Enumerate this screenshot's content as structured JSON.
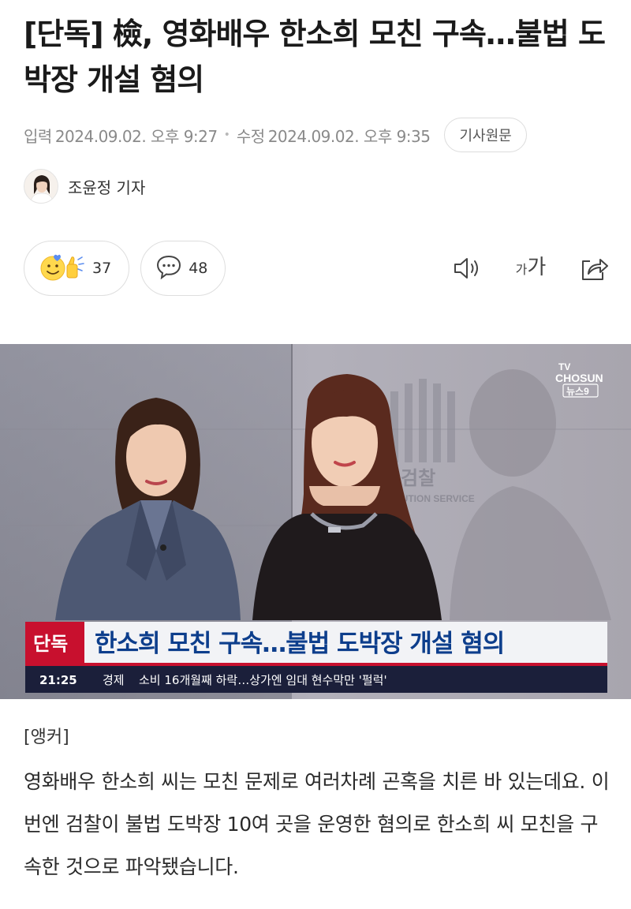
{
  "article": {
    "headline": "[단독] 檢, 영화배우 한소희 모친 구속…불법 도박장 개설 혐의",
    "meta": {
      "input_label": "입력",
      "input_date": "2024.09.02. 오후 9:27",
      "edit_label": "수정",
      "edit_date": "2024.09.02. 오후 9:35",
      "original_button": "기사원문"
    },
    "reporter": "조윤정 기자",
    "reactions": {
      "likes": "37",
      "comments": "48"
    },
    "font_small": "가",
    "font_big": "가",
    "anchor_label": "[앵커]",
    "body": "영화배우 한소희 씨는 모친 문제로 여러차례 곤혹을 치른 바 있는데요. 이번엔 검찰이 불법 도박장 10여 곳을 운영한 혐의로 한소희 씨 모친을 구속한 것으로 파악됐습니다."
  },
  "broadcast": {
    "channel_top": "TV",
    "channel_name": "CHOSUN",
    "channel_sub": "뉴스9",
    "wall_text": "검찰",
    "wall_sub": "CUTION SERVICE",
    "exclusive_tag": "단독",
    "headline": "한소희 모친 구속…불법 도박장 개설 혐의",
    "ticker_time": "21:25",
    "ticker_category": "경제",
    "ticker_text": "소비 16개월째 하락…상가엔 임대 현수막만 '펄럭'"
  },
  "icons": [
    "emoji-reaction-icon",
    "comment-icon",
    "speaker-icon",
    "font-size-icon",
    "share-icon"
  ],
  "colors": {
    "ticker_red": "#c8102e",
    "headline_blue": "#0d3e8c",
    "ticker_bg": "#1b1f3a"
  }
}
